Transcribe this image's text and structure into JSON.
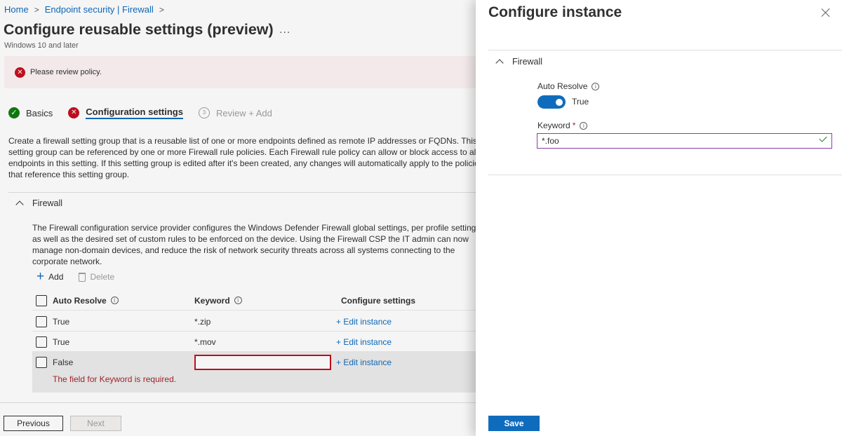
{
  "breadcrumb": {
    "items": [
      "Home",
      "Endpoint security | Firewall"
    ]
  },
  "page": {
    "title": "Configure reusable settings (preview)",
    "more": "...",
    "subtitle": "Windows 10 and later"
  },
  "banner": {
    "message": "Please review policy."
  },
  "steps": [
    {
      "label": "Basics",
      "status": "complete"
    },
    {
      "label": "Configuration settings",
      "status": "error"
    },
    {
      "number": "3",
      "label": "Review + Add",
      "status": "pending"
    }
  ],
  "description": [
    "Create a firewall setting group that is a reusable list of one or more endpoints defined as remote IP addresses or FQDNs. This",
    "setting group can be referenced by one or more Firewall rule policies. Each Firewall rule policy can allow or block access to all",
    "endpoints in this setting. If this setting group is edited after it's been created, any changes will automatically apply to the policies",
    "that reference this setting group."
  ],
  "firewall_section": {
    "title": "Firewall",
    "description": [
      "The Firewall configuration service provider configures the Windows Defender Firewall global settings, per profile settings,",
      "as well as the desired set of custom rules to be enforced on the device. Using the Firewall CSP the IT admin can now",
      "manage non-domain devices, and reduce the risk of network security threats across all systems connecting to the",
      "corporate network."
    ],
    "toolbar": {
      "add": "Add",
      "delete": "Delete"
    },
    "columns": {
      "auto_resolve": "Auto Resolve",
      "keyword": "Keyword",
      "configure": "Configure settings"
    },
    "rows": [
      {
        "auto_resolve": "True",
        "keyword": "*.zip",
        "action": "+ Edit instance"
      },
      {
        "auto_resolve": "True",
        "keyword": "*.mov",
        "action": "+ Edit instance"
      },
      {
        "auto_resolve": "False",
        "keyword": "",
        "action": "+ Edit instance",
        "error": "The field for Keyword is required."
      }
    ]
  },
  "footer": {
    "previous": "Previous",
    "next": "Next"
  },
  "panel": {
    "title": "Configure instance",
    "section": "Firewall",
    "auto_resolve_label": "Auto Resolve",
    "toggle_text": "True",
    "keyword_label": "Keyword",
    "required_mark": "*",
    "keyword_value": "*.foo",
    "save": "Save"
  },
  "colors": {
    "accent": "#0f6cbd",
    "error": "#c50f1f",
    "success": "#107c10",
    "banner_bg": "#fdf3f4",
    "input_focus_border": "#8a3fa7"
  }
}
